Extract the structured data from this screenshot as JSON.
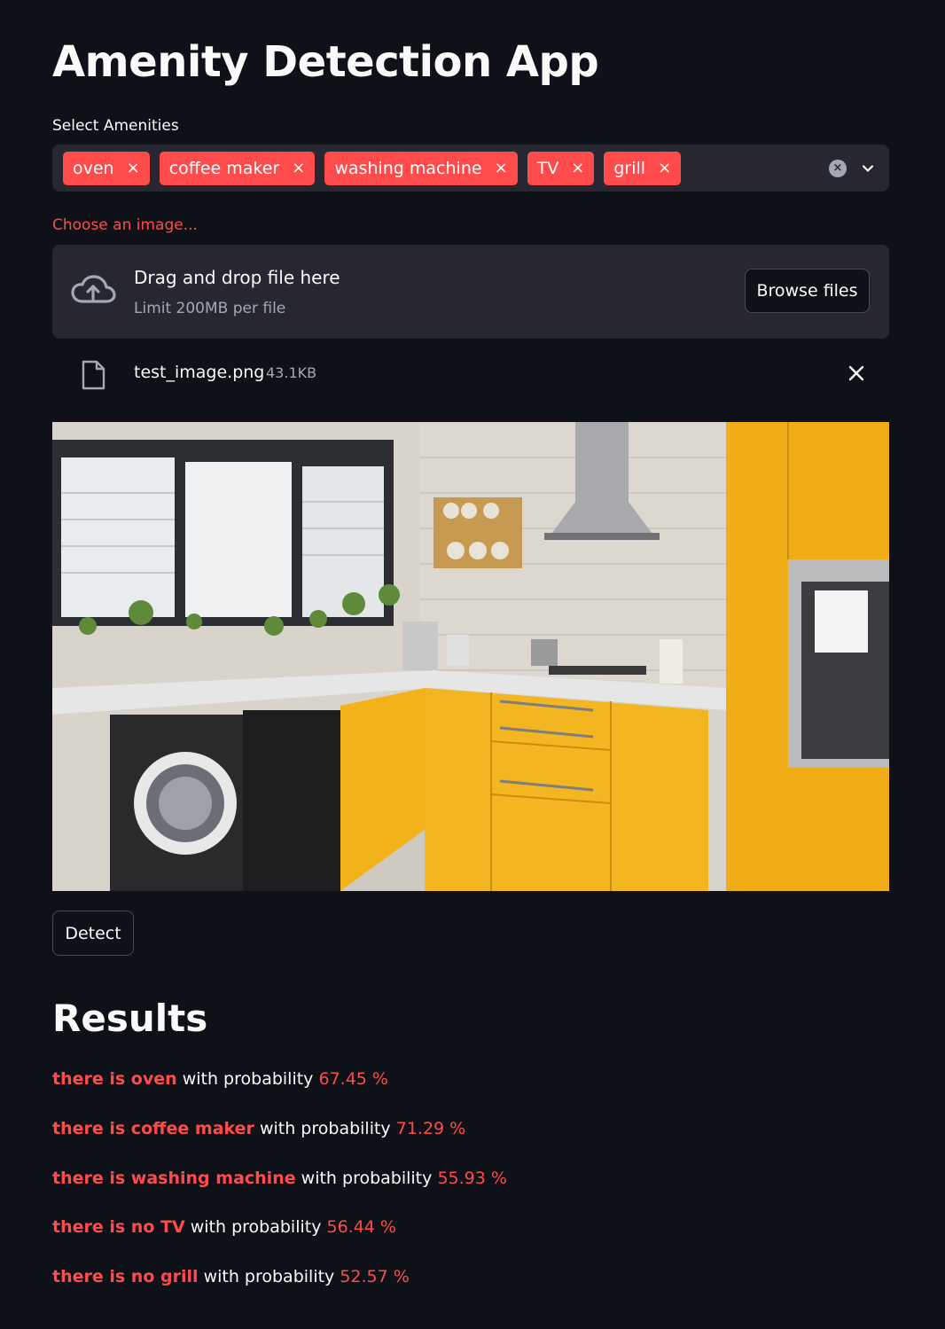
{
  "app": {
    "title": "Amenity Detection App"
  },
  "amenities": {
    "label": "Select Amenities",
    "selected": [
      "oven",
      "coffee maker",
      "washing machine",
      "TV",
      "grill"
    ],
    "remove_glyph": "×",
    "clear_glyph": "×"
  },
  "uploader": {
    "label": "Choose an image...",
    "drop_text": "Drag and drop file here",
    "limit_text": "Limit 200MB per file",
    "browse_label": "Browse files",
    "file": {
      "name": "test_image.png",
      "size": "43.1KB"
    }
  },
  "actions": {
    "detect_label": "Detect"
  },
  "results": {
    "heading": "Results",
    "items": [
      {
        "lead": "there is oven",
        "mid": "with probability",
        "prob": "67.45 %"
      },
      {
        "lead": "there is coffee maker",
        "mid": "with probability",
        "prob": "71.29 %"
      },
      {
        "lead": "there is washing machine",
        "mid": "with probability",
        "prob": "55.93 %"
      },
      {
        "lead": "there is no TV",
        "mid": "with probability",
        "prob": "56.44 %"
      },
      {
        "lead": "there is no grill",
        "mid": "with probability",
        "prob": "52.57 %"
      }
    ]
  },
  "colors": {
    "background": "#0e1117",
    "accent": "#ff4b4b",
    "panel": "#262730",
    "muted_text": "#a3a8b4"
  },
  "icons": {
    "upload": "cloud-upload-icon",
    "file": "file-icon",
    "close": "close-icon",
    "clear": "clear-all-icon",
    "dropdown": "chevron-down-icon"
  }
}
